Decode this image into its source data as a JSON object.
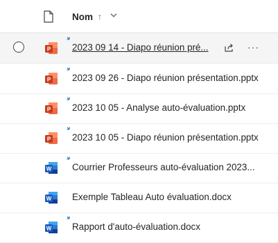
{
  "header": {
    "name_label": "Nom",
    "sort_glyph": "↑",
    "file_type_icon": "document-icon",
    "dropdown_icon": "chevron-down-icon"
  },
  "files": [
    {
      "name": "2023 09 14 - Diapo réunion pré...",
      "type": "pptx",
      "selected": true
    },
    {
      "name": "2023 09 26 - Diapo réunion présentation.pptx",
      "type": "pptx"
    },
    {
      "name": "2023 10 05 - Analyse auto-évaluation.pptx",
      "type": "pptx"
    },
    {
      "name": "2023 10 05 - Diapo réunion présentation.pptx",
      "type": "pptx"
    },
    {
      "name": "Courrier Professeurs auto-évaluation 2023...",
      "type": "docx"
    },
    {
      "name": "Exemple Tableau Auto évaluation.docx",
      "type": "docx"
    },
    {
      "name": "Rapport d'auto-évaluation.docx",
      "type": "docx"
    }
  ],
  "row_actions": {
    "share_icon": "share-icon",
    "more_label": "···"
  },
  "colors": {
    "powerpoint": "#c43e1c",
    "word": "#185abd",
    "new_marker": "#0f6cbd",
    "selected_row": "#f5f5f5"
  }
}
